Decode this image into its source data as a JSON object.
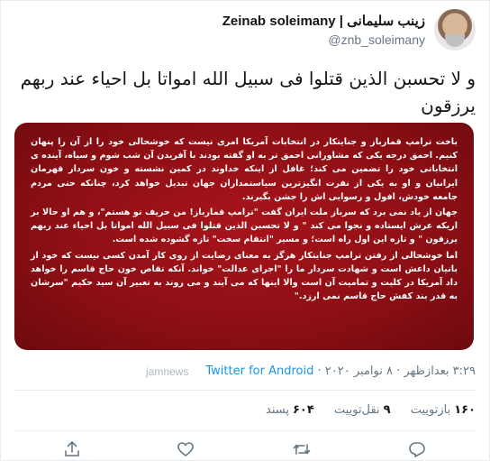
{
  "author": {
    "name_fa": "زینب سلیمانی",
    "separator": "|",
    "name_en": "Zeinab soleimany",
    "handle": "@znb_soleimany"
  },
  "tweet": {
    "text": "و لا تحسبن الذین قتلوا فی سبیل الله امواتا بل احیاء عند ربهم یرزقون"
  },
  "media": {
    "paragraphs": [
      "باخت ترامپ قمارباز و جنایتکار در انتخابات آمریکا امری نیست که خوشحالی خود را از آن را پنهان کنیم. احمق درجه یکی که مشاورانی احمق تر به او گفته بودند با آفریدن آن شب شوم و سیاه، آینده ی انتخاباتی خود را تضمین می کند؛ غافل از اینکه خداوند در کمین نشسته و خون سردار قهرمان ایرانیان و او به یکی از نفرت انگیزترین سیاستمداران جهان تبدیل خواهد کرد، چنانکه حتی مردم جامعه خودش، افول و رسوایی اش را جشن بگیرند.",
      "جهان از یاد نمی برد که سرباز ملت ایران گفت \"ترامپ قمارباز! من حریف تو هستم\"، و هم او حالا بر اریکه عرش ایستاده و نجوا می کند \" و لا تحسبن الذین قتلوا فی سبیل الله امواتا بل احیاء عند ربهم یرزقون \" و تازه این اول راه است؛ و مسیر \"انتقام سخت\" تازه گشوده شده است.",
      "اما خوشحالی از رفتن ترامپ جنایتکار هرگز به معنای رضایت از روی کار آمدن کسی نیست که خود از بانیان داعش است و شهادت سردار ما را \"اجرای عدالت\" خواند. آنکه تقاص خون حاج قاسم را خواهد داد آمریکا در کلیت و تمامیت آن است والا اینها که می آیند و می روند به تعبیر آن سید حکیم \"سرشان به قدر بند کفش حاج قاسم نمی ارزد.\""
    ]
  },
  "meta": {
    "time": "۳:۲۹ بعدازظهر",
    "dot1": "·",
    "date": "۸ نوامبر ۲۰۲۰",
    "dot2": "·",
    "source": "Twitter for Android"
  },
  "watermark": "jamnews",
  "stats": {
    "retweets_count": "۱۶۰",
    "retweets_label": "بازتوییت",
    "quotes_count": "۹",
    "quotes_label": "نقل‌توییت",
    "likes_count": "۶۰۴",
    "likes_label": "پسند"
  },
  "actions": [
    "reply-icon",
    "retweet-icon",
    "like-icon",
    "share-icon"
  ],
  "colors": {
    "accent": "#1b95e0",
    "secondary_text": "#657786",
    "media_red": "#8e0f15"
  }
}
